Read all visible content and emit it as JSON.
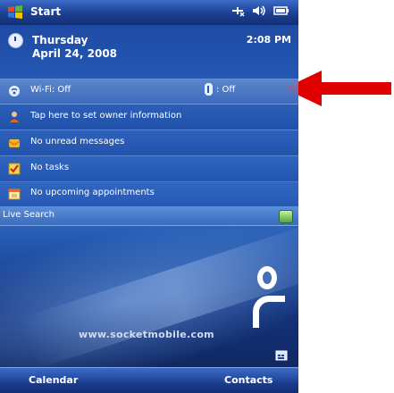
{
  "topbar": {
    "start_label": "Start"
  },
  "today": {
    "day": "Thursday",
    "date": "April 24, 2008",
    "time": "2:08 PM"
  },
  "rows": [
    {
      "label": "Wi-Fi: Off",
      "icon": "wifi-icon"
    },
    {
      "label": "Tap here to set owner information",
      "icon": "owner-icon"
    },
    {
      "label": "No unread messages",
      "icon": "messages-icon"
    },
    {
      "label": "No tasks",
      "icon": "tasks-icon"
    },
    {
      "label": "No upcoming appointments",
      "icon": "calendar-icon"
    }
  ],
  "bluetooth": {
    "status": ": Off",
    "icon": "bluetooth-icon"
  },
  "live_search": {
    "label": "Live Search",
    "go_icon": "search-go-icon"
  },
  "branding": {
    "website": "www.socketmobile.com"
  },
  "softkeys": {
    "left": "Calendar",
    "right": "Contacts"
  },
  "colors": {
    "annotation_arrow": "#e00000",
    "accent_blue": "#1b3f92"
  }
}
